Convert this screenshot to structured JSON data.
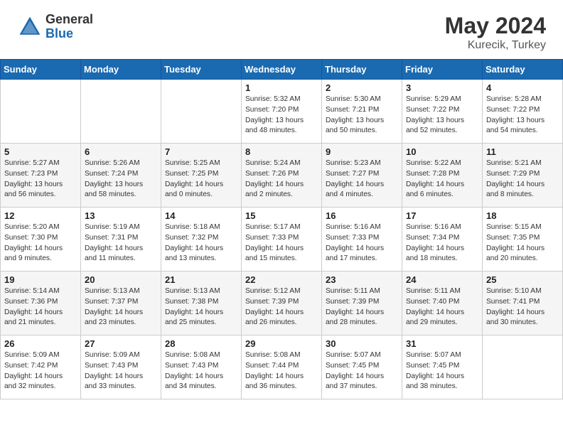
{
  "header": {
    "logo_general": "General",
    "logo_blue": "Blue",
    "month_year": "May 2024",
    "location": "Kurecik, Turkey"
  },
  "days_of_week": [
    "Sunday",
    "Monday",
    "Tuesday",
    "Wednesday",
    "Thursday",
    "Friday",
    "Saturday"
  ],
  "weeks": [
    [
      {
        "day": "",
        "info": ""
      },
      {
        "day": "",
        "info": ""
      },
      {
        "day": "",
        "info": ""
      },
      {
        "day": "1",
        "info": "Sunrise: 5:32 AM\nSunset: 7:20 PM\nDaylight: 13 hours\nand 48 minutes."
      },
      {
        "day": "2",
        "info": "Sunrise: 5:30 AM\nSunset: 7:21 PM\nDaylight: 13 hours\nand 50 minutes."
      },
      {
        "day": "3",
        "info": "Sunrise: 5:29 AM\nSunset: 7:22 PM\nDaylight: 13 hours\nand 52 minutes."
      },
      {
        "day": "4",
        "info": "Sunrise: 5:28 AM\nSunset: 7:22 PM\nDaylight: 13 hours\nand 54 minutes."
      }
    ],
    [
      {
        "day": "5",
        "info": "Sunrise: 5:27 AM\nSunset: 7:23 PM\nDaylight: 13 hours\nand 56 minutes."
      },
      {
        "day": "6",
        "info": "Sunrise: 5:26 AM\nSunset: 7:24 PM\nDaylight: 13 hours\nand 58 minutes."
      },
      {
        "day": "7",
        "info": "Sunrise: 5:25 AM\nSunset: 7:25 PM\nDaylight: 14 hours\nand 0 minutes."
      },
      {
        "day": "8",
        "info": "Sunrise: 5:24 AM\nSunset: 7:26 PM\nDaylight: 14 hours\nand 2 minutes."
      },
      {
        "day": "9",
        "info": "Sunrise: 5:23 AM\nSunset: 7:27 PM\nDaylight: 14 hours\nand 4 minutes."
      },
      {
        "day": "10",
        "info": "Sunrise: 5:22 AM\nSunset: 7:28 PM\nDaylight: 14 hours\nand 6 minutes."
      },
      {
        "day": "11",
        "info": "Sunrise: 5:21 AM\nSunset: 7:29 PM\nDaylight: 14 hours\nand 8 minutes."
      }
    ],
    [
      {
        "day": "12",
        "info": "Sunrise: 5:20 AM\nSunset: 7:30 PM\nDaylight: 14 hours\nand 9 minutes."
      },
      {
        "day": "13",
        "info": "Sunrise: 5:19 AM\nSunset: 7:31 PM\nDaylight: 14 hours\nand 11 minutes."
      },
      {
        "day": "14",
        "info": "Sunrise: 5:18 AM\nSunset: 7:32 PM\nDaylight: 14 hours\nand 13 minutes."
      },
      {
        "day": "15",
        "info": "Sunrise: 5:17 AM\nSunset: 7:33 PM\nDaylight: 14 hours\nand 15 minutes."
      },
      {
        "day": "16",
        "info": "Sunrise: 5:16 AM\nSunset: 7:33 PM\nDaylight: 14 hours\nand 17 minutes."
      },
      {
        "day": "17",
        "info": "Sunrise: 5:16 AM\nSunset: 7:34 PM\nDaylight: 14 hours\nand 18 minutes."
      },
      {
        "day": "18",
        "info": "Sunrise: 5:15 AM\nSunset: 7:35 PM\nDaylight: 14 hours\nand 20 minutes."
      }
    ],
    [
      {
        "day": "19",
        "info": "Sunrise: 5:14 AM\nSunset: 7:36 PM\nDaylight: 14 hours\nand 21 minutes."
      },
      {
        "day": "20",
        "info": "Sunrise: 5:13 AM\nSunset: 7:37 PM\nDaylight: 14 hours\nand 23 minutes."
      },
      {
        "day": "21",
        "info": "Sunrise: 5:13 AM\nSunset: 7:38 PM\nDaylight: 14 hours\nand 25 minutes."
      },
      {
        "day": "22",
        "info": "Sunrise: 5:12 AM\nSunset: 7:39 PM\nDaylight: 14 hours\nand 26 minutes."
      },
      {
        "day": "23",
        "info": "Sunrise: 5:11 AM\nSunset: 7:39 PM\nDaylight: 14 hours\nand 28 minutes."
      },
      {
        "day": "24",
        "info": "Sunrise: 5:11 AM\nSunset: 7:40 PM\nDaylight: 14 hours\nand 29 minutes."
      },
      {
        "day": "25",
        "info": "Sunrise: 5:10 AM\nSunset: 7:41 PM\nDaylight: 14 hours\nand 30 minutes."
      }
    ],
    [
      {
        "day": "26",
        "info": "Sunrise: 5:09 AM\nSunset: 7:42 PM\nDaylight: 14 hours\nand 32 minutes."
      },
      {
        "day": "27",
        "info": "Sunrise: 5:09 AM\nSunset: 7:43 PM\nDaylight: 14 hours\nand 33 minutes."
      },
      {
        "day": "28",
        "info": "Sunrise: 5:08 AM\nSunset: 7:43 PM\nDaylight: 14 hours\nand 34 minutes."
      },
      {
        "day": "29",
        "info": "Sunrise: 5:08 AM\nSunset: 7:44 PM\nDaylight: 14 hours\nand 36 minutes."
      },
      {
        "day": "30",
        "info": "Sunrise: 5:07 AM\nSunset: 7:45 PM\nDaylight: 14 hours\nand 37 minutes."
      },
      {
        "day": "31",
        "info": "Sunrise: 5:07 AM\nSunset: 7:45 PM\nDaylight: 14 hours\nand 38 minutes."
      },
      {
        "day": "",
        "info": ""
      }
    ]
  ]
}
